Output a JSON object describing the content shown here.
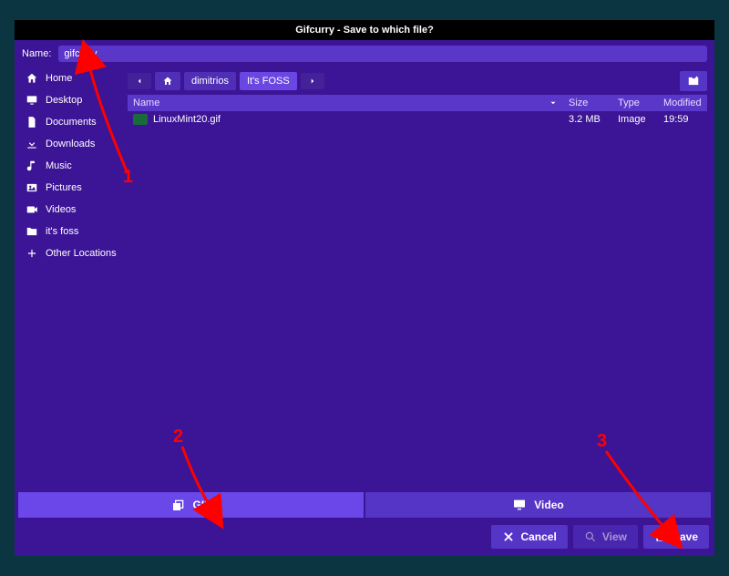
{
  "title": "Gifcurry - Save to which file?",
  "name_label": "Name:",
  "name_value": "gifcurry",
  "sidebar": {
    "items": [
      {
        "label": "Home",
        "icon": "home"
      },
      {
        "label": "Desktop",
        "icon": "desktop"
      },
      {
        "label": "Documents",
        "icon": "documents"
      },
      {
        "label": "Downloads",
        "icon": "downloads"
      },
      {
        "label": "Music",
        "icon": "music"
      },
      {
        "label": "Pictures",
        "icon": "pictures"
      },
      {
        "label": "Videos",
        "icon": "videos"
      },
      {
        "label": "it's foss",
        "icon": "folder"
      },
      {
        "label": "Other Locations",
        "icon": "plus"
      }
    ]
  },
  "path": {
    "segments": [
      "dimitrios",
      "It's FOSS"
    ]
  },
  "columns": {
    "name": "Name",
    "size": "Size",
    "type": "Type",
    "modified": "Modified"
  },
  "files": [
    {
      "name": "LinuxMint20.gif",
      "size": "3.2 MB",
      "type": "Image",
      "modified": "19:59"
    }
  ],
  "format": {
    "gif": "GIF",
    "video": "Video"
  },
  "actions": {
    "cancel": "Cancel",
    "view": "View",
    "save": "Save"
  },
  "annotations": {
    "a1": "1",
    "a2": "2",
    "a3": "3"
  }
}
